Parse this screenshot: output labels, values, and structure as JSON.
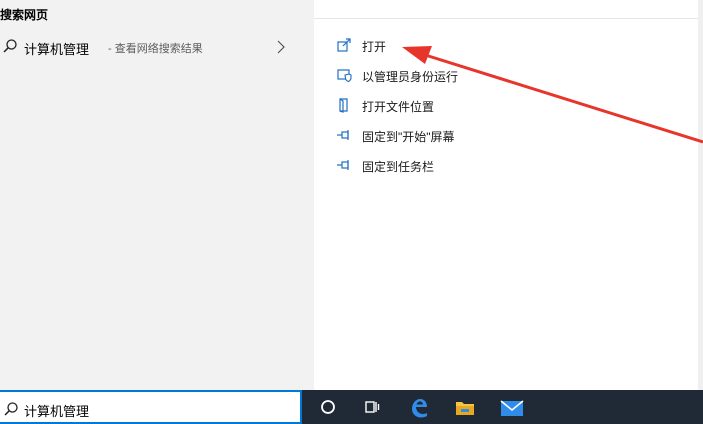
{
  "left": {
    "section_heading": "搜索网页",
    "result": {
      "title": "计算机管理",
      "subtitle": "- 查看网络搜索结果",
      "icon": "search-icon",
      "chevron_icon": "chevron-right-icon"
    }
  },
  "actions": [
    {
      "label": "打开",
      "icon": "open-icon"
    },
    {
      "label": "以管理员身份运行",
      "icon": "admin-shield-icon"
    },
    {
      "label": "打开文件位置",
      "icon": "file-location-icon"
    },
    {
      "label": "固定到\"开始\"屏幕",
      "icon": "pin-icon"
    },
    {
      "label": "固定到任务栏",
      "icon": "pin-icon"
    }
  ],
  "search": {
    "query": "计算机管理"
  },
  "taskbar": {
    "items": [
      "cortana-icon",
      "task-view-icon",
      "edge-icon",
      "file-explorer-icon",
      "mail-icon"
    ]
  },
  "colors": {
    "accent": "#0078d7",
    "taskbar": "#1f2a36",
    "icon_blue": "#1f6fc4",
    "annotation_red": "#e8352b"
  }
}
